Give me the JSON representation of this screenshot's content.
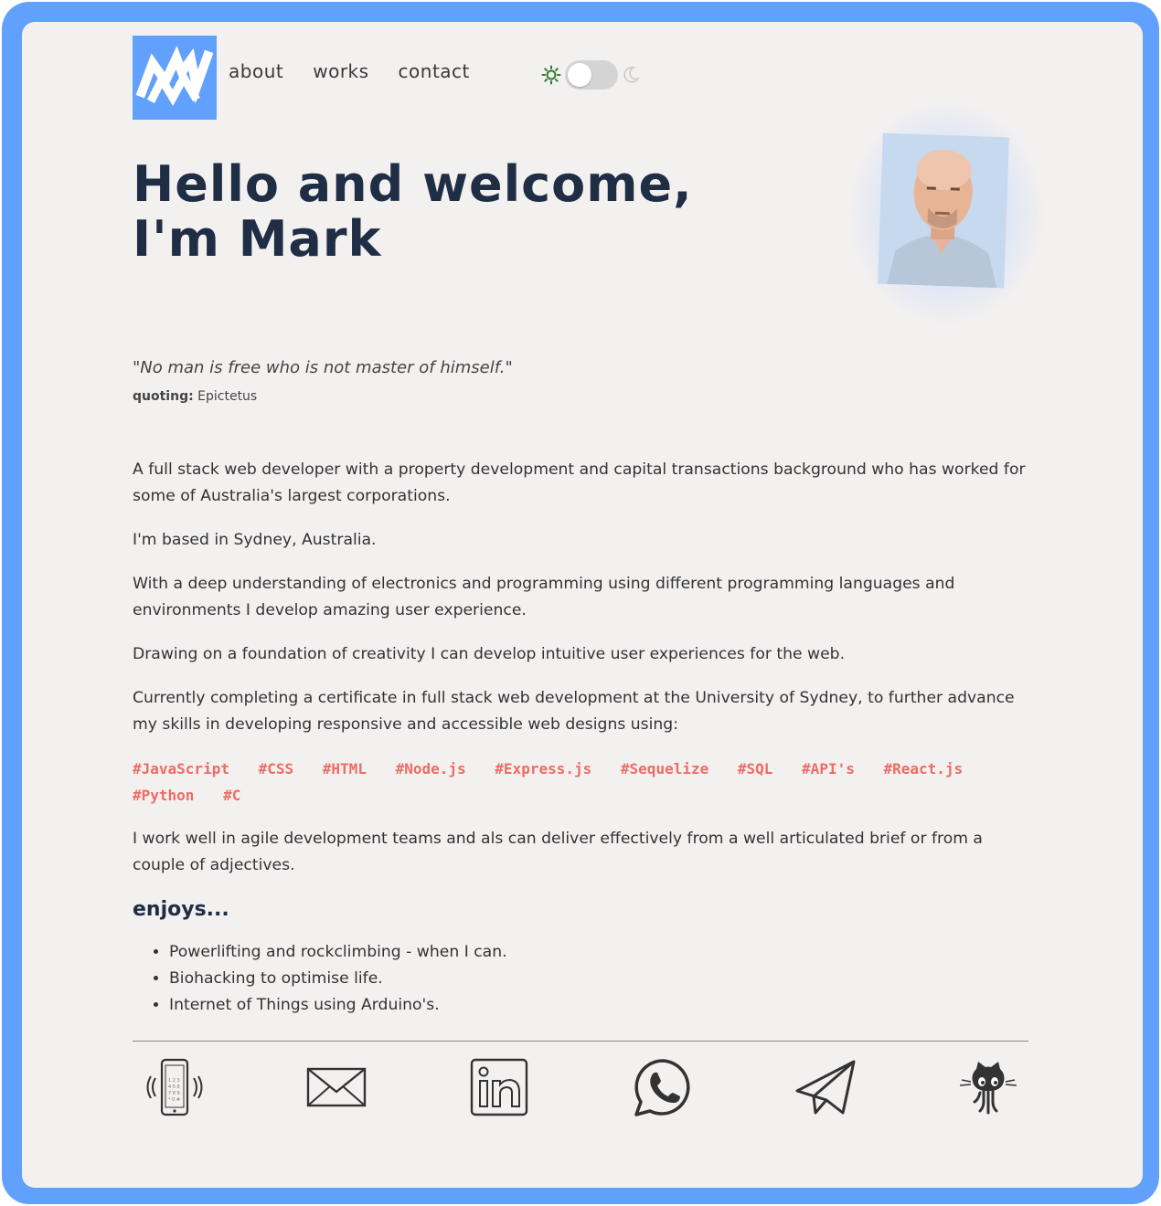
{
  "nav": {
    "items": [
      {
        "label": "about"
      },
      {
        "label": "works"
      },
      {
        "label": "contact"
      }
    ]
  },
  "hero": {
    "line1": "Hello and welcome,",
    "line2": "I'm Mark"
  },
  "quote": {
    "text": "\"No man is free who is not master of himself.\"",
    "prefix": "quoting:",
    "author": "Epictetus"
  },
  "about": {
    "paragraphs": [
      "A full stack web developer with a property development and capital transactions background who has worked for some of Australia's largest corporations.",
      "I'm based in Sydney, Australia.",
      "With a deep understanding of electronics and programming using different programming languages and environments I develop amazing user experience.",
      "Drawing on a foundation of creativity I can develop intuitive user experiences for the web.",
      "Currently completing a certificate in full stack web development at the University of Sydney, to further advance my skills in developing responsive and accessible web designs using:"
    ],
    "tags": [
      "#JavaScript",
      "#CSS",
      "#HTML",
      "#Node.js",
      "#Express.js",
      "#Sequelize",
      "#SQL",
      "#API's",
      "#React.js",
      "#Python",
      "#C"
    ],
    "closing": "I work well in agile development teams and als can deliver effectively from a well articulated brief or from a couple of adjectives."
  },
  "enjoys": {
    "title": "enjoys...",
    "items": [
      "Powerlifting and rockclimbing - when I can.",
      "Biohacking to optimise life.",
      "Internet of Things using Arduino's."
    ]
  },
  "contact_icons": [
    "phone-icon",
    "email-icon",
    "linkedin-icon",
    "whatsapp-icon",
    "telegram-icon",
    "github-icon"
  ],
  "colors": {
    "frame": "#62a0fd",
    "panel": "#f3f0f0",
    "heading": "#1f2d45",
    "tag": "#ee6c64",
    "sun": "#2f7d32"
  }
}
